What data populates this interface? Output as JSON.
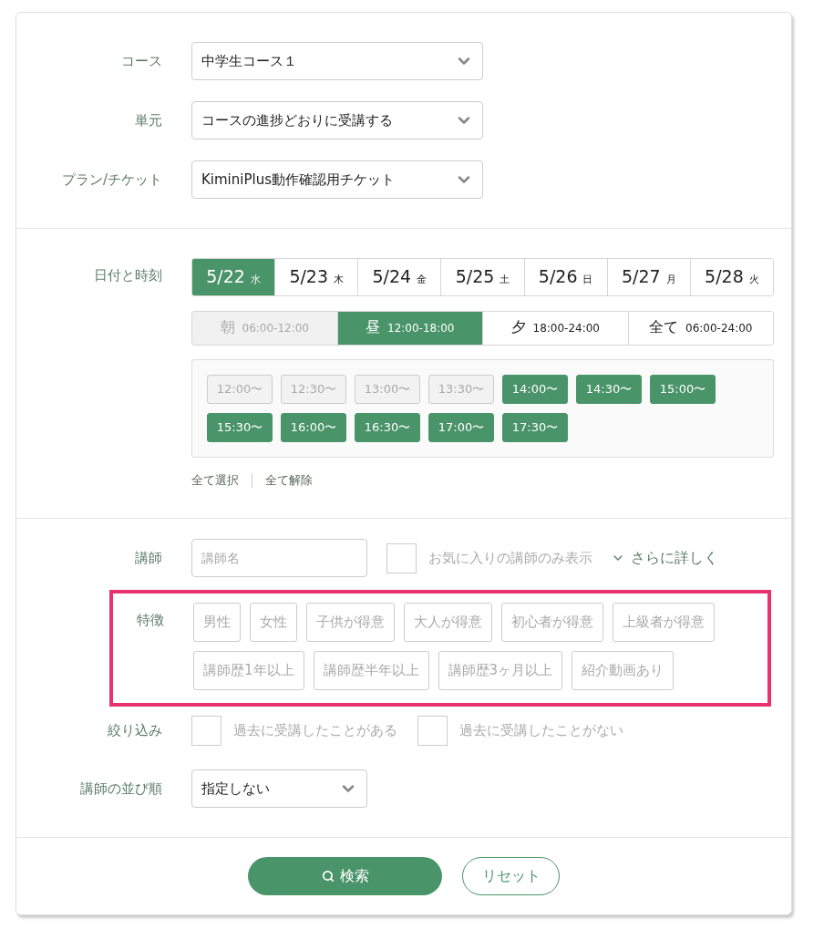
{
  "course_fields": [
    {
      "label": "コース",
      "value": "中学生コース１"
    },
    {
      "label": "単元",
      "value": "コースの進捗どおりに受講する"
    },
    {
      "label": "プラン/チケット",
      "value": "KiminiPlus動作確認用チケット"
    }
  ],
  "datetime": {
    "label": "日付と時刻",
    "dates": [
      {
        "date": "5/22",
        "weekday": "水",
        "selected": true
      },
      {
        "date": "5/23",
        "weekday": "木",
        "selected": false
      },
      {
        "date": "5/24",
        "weekday": "金",
        "selected": false
      },
      {
        "date": "5/25",
        "weekday": "土",
        "selected": false
      },
      {
        "date": "5/26",
        "weekday": "日",
        "selected": false
      },
      {
        "date": "5/27",
        "weekday": "月",
        "selected": false
      },
      {
        "date": "5/28",
        "weekday": "火",
        "selected": false
      }
    ],
    "periods": [
      {
        "name": "朝",
        "range": "06:00-12:00",
        "selected": false,
        "disabled": true
      },
      {
        "name": "昼",
        "range": "12:00-18:00",
        "selected": true,
        "disabled": false
      },
      {
        "name": "夕",
        "range": "18:00-24:00",
        "selected": false,
        "disabled": false
      },
      {
        "name": "全て",
        "range": "06:00-24:00",
        "selected": false,
        "disabled": false
      }
    ],
    "slots": [
      {
        "time": "12:00〜",
        "selected": false
      },
      {
        "time": "12:30〜",
        "selected": false
      },
      {
        "time": "13:00〜",
        "selected": false
      },
      {
        "time": "13:30〜",
        "selected": false
      },
      {
        "time": "14:00〜",
        "selected": true
      },
      {
        "time": "14:30〜",
        "selected": true
      },
      {
        "time": "15:00〜",
        "selected": true
      },
      {
        "time": "15:30〜",
        "selected": true
      },
      {
        "time": "16:00〜",
        "selected": true
      },
      {
        "time": "16:30〜",
        "selected": true
      },
      {
        "time": "17:00〜",
        "selected": true
      },
      {
        "time": "17:30〜",
        "selected": true
      }
    ],
    "links": [
      "全て選択",
      "全て解除"
    ]
  },
  "teacher": {
    "label": "講師",
    "placeholder": "講師名",
    "favorite": {
      "label": "お気に入りの講師のみ表示",
      "checked": false
    },
    "more": "さらに詳しく"
  },
  "features": {
    "label": "特徴",
    "highlighted": true,
    "tags": [
      {
        "label": "男性",
        "selected": false
      },
      {
        "label": "女性",
        "selected": false
      },
      {
        "label": "子供が得意",
        "selected": false
      },
      {
        "label": "大人が得意",
        "selected": false
      },
      {
        "label": "初心者が得意",
        "selected": false
      },
      {
        "label": "上級者が得意",
        "selected": false
      },
      {
        "label": "講師歴1年以上",
        "selected": false
      },
      {
        "label": "講師歴半年以上",
        "selected": false
      },
      {
        "label": "講師歴3ヶ月以上",
        "selected": false
      },
      {
        "label": "紹介動画あり",
        "selected": false
      }
    ]
  },
  "filter": {
    "label": "絞り込み",
    "options": [
      {
        "label": "過去に受講したことがある",
        "checked": false
      },
      {
        "label": "過去に受講したことがない",
        "checked": false
      }
    ]
  },
  "sort": {
    "label": "講師の並び順",
    "value": "指定しない"
  },
  "buttons": {
    "search": "検索",
    "reset": "リセット"
  }
}
